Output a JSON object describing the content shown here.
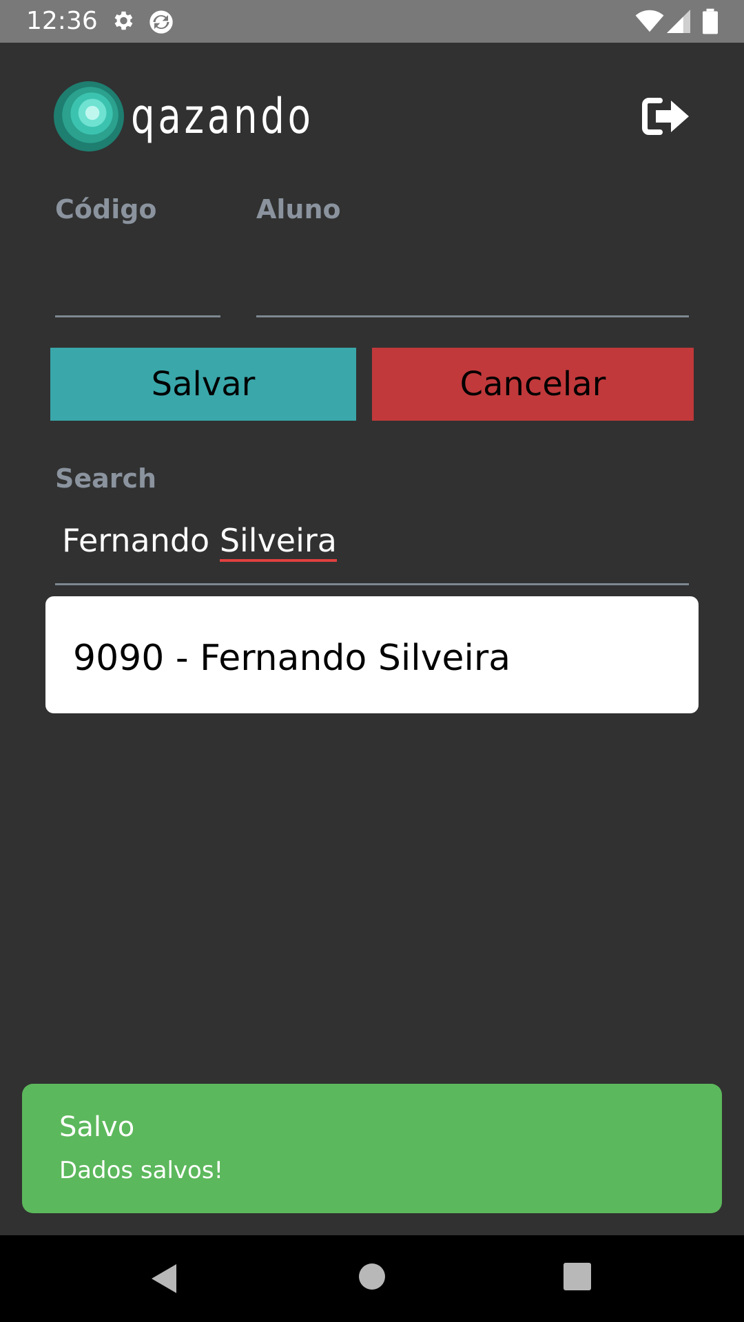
{
  "status_bar": {
    "time": "12:36",
    "icons": [
      "gear-icon",
      "sync-icon",
      "wifi-icon",
      "signal-icon",
      "battery-icon"
    ]
  },
  "header": {
    "logo_text": "qazando",
    "logout_icon": "logout-icon"
  },
  "form": {
    "codigo_label": "Código",
    "codigo_value": "",
    "aluno_label": "Aluno",
    "aluno_value": ""
  },
  "buttons": {
    "save_label": "Salvar",
    "cancel_label": "Cancelar",
    "save_color": "#3aa7aa",
    "cancel_color": "#c1393b"
  },
  "search": {
    "label": "Search",
    "value_first": "Fernando",
    "value_second": "Silveira"
  },
  "results": [
    {
      "text": "9090 - Fernando Silveira"
    }
  ],
  "toast": {
    "title": "Salvo",
    "message": "Dados salvos!",
    "color": "#5cb85c"
  },
  "nav_bar": {
    "icons": [
      "back-icon",
      "home-icon",
      "recents-icon"
    ]
  }
}
